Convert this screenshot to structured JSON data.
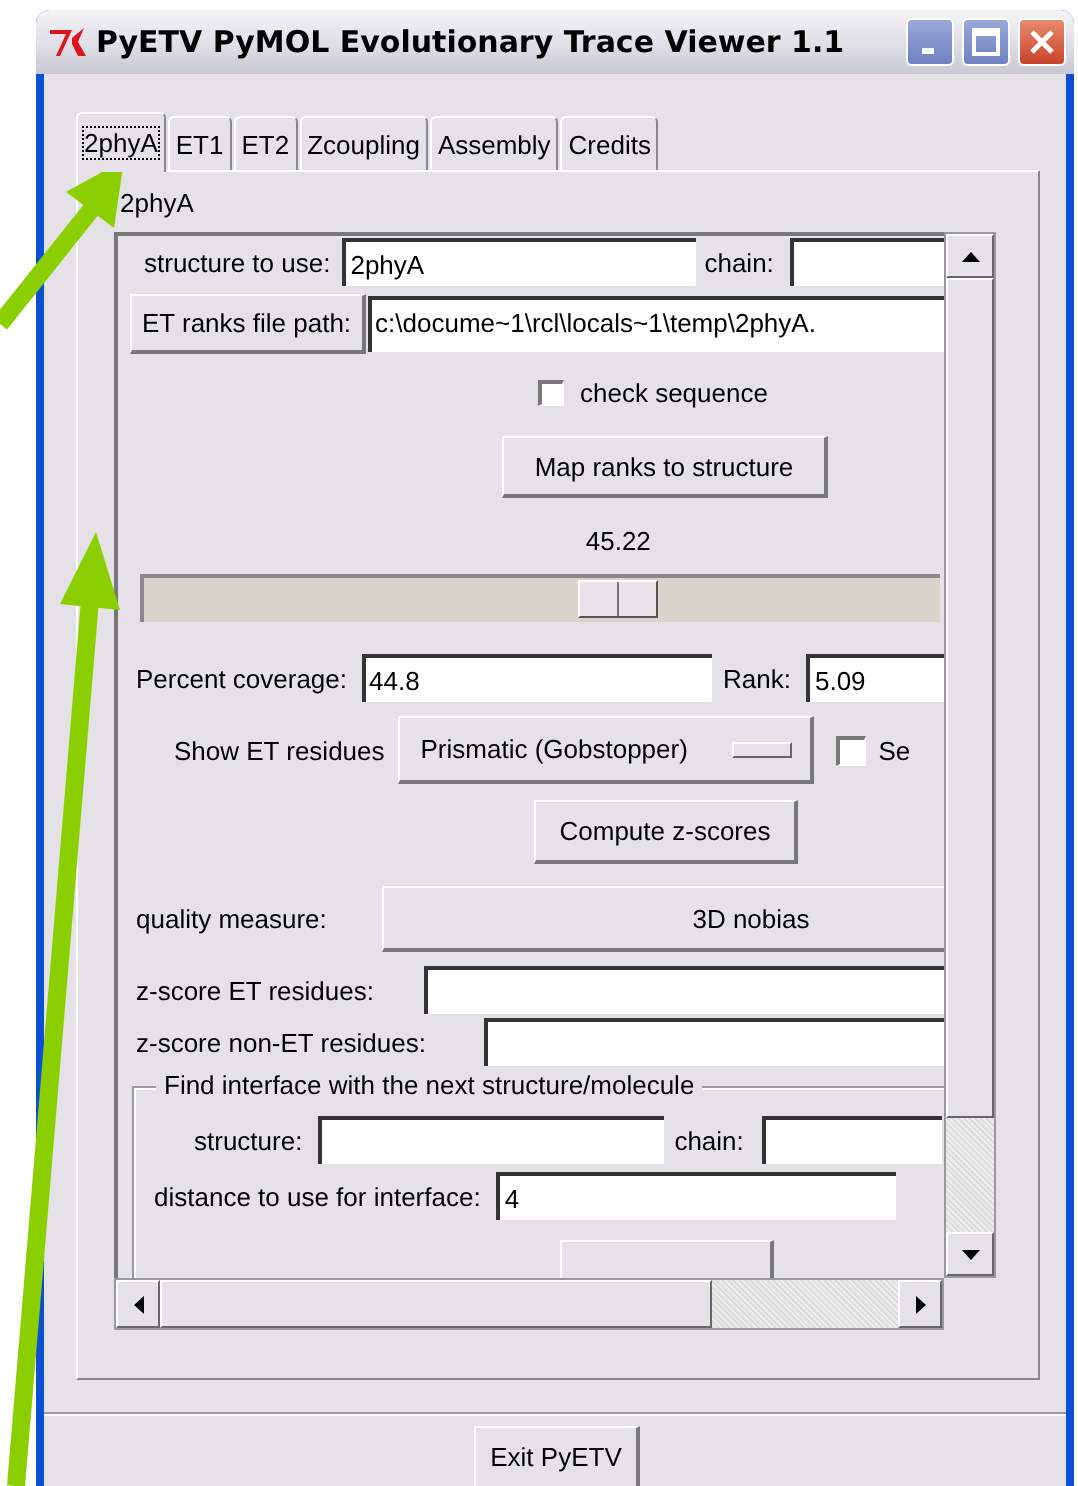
{
  "window": {
    "title": "PyETV PyMOL Evolutionary Trace Viewer 1.1"
  },
  "tabs": [
    {
      "label": "2phyA",
      "selected": true
    },
    {
      "label": "ET1",
      "selected": false
    },
    {
      "label": "ET2",
      "selected": false
    },
    {
      "label": "Zcoupling",
      "selected": false
    },
    {
      "label": "Assembly",
      "selected": false
    },
    {
      "label": "Credits",
      "selected": false
    }
  ],
  "panel": {
    "title": "2phyA",
    "structure_label": "structure to use:",
    "structure_value": "2phyA",
    "chain_label": "chain:",
    "ranks_button": "ET ranks file path:",
    "ranks_path": "c:\\docume~1\\rcl\\locals~1\\temp\\2phyA.",
    "check_sequence": {
      "label": "check sequence",
      "checked": false
    },
    "map_button": "Map ranks to structure",
    "slider": {
      "reading": "45.22",
      "level": 0.61
    },
    "coverage_label": "Percent coverage:",
    "coverage_value": "44.8",
    "rank_label": "Rank:",
    "rank_value": "5.09",
    "show_label": "Show ET residues",
    "show_menu": "Prismatic (Gobstopper)",
    "se_check": {
      "label": "Se",
      "checked": false
    },
    "compute_button": "Compute z-scores",
    "quality_label": "quality measure:",
    "quality_value": "3D nobias",
    "zscore_et_label": "z-score ET residues:",
    "zscore_non_et_label": "z-score non-ET residues:",
    "interface": {
      "title": "Find interface with the next structure/molecule",
      "structure_label": "structure:",
      "chain_label": "chain:",
      "distance_label": "distance to use for interface:",
      "distance_value": "4"
    }
  },
  "exit_button": "Exit PyETV"
}
